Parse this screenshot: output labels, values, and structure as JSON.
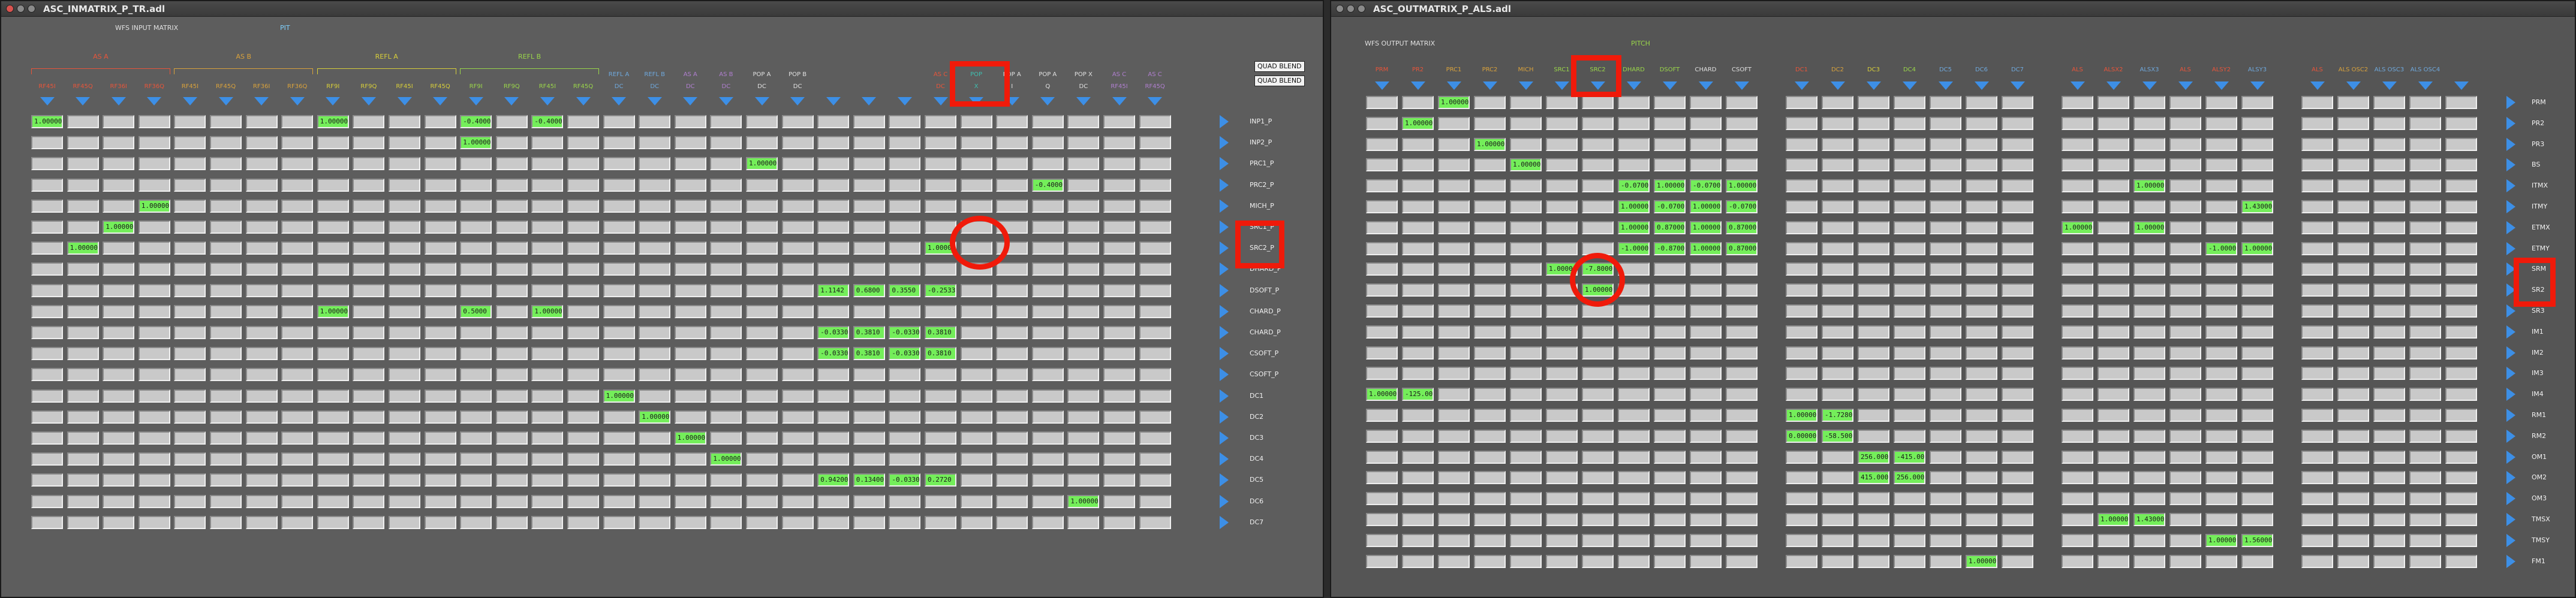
{
  "colors": {
    "cell": "#c9c9c9",
    "cell_value": "#74ee5a",
    "arrow": "#3d8fe6",
    "highlight": "#f01a0a",
    "bg": "#5d5d5d"
  },
  "left": {
    "title": "ASC_INMATRIX_P_TR.adl",
    "heading": "WFS INPUT MATRIX",
    "subheading": "PIT",
    "groups": [
      {
        "name": "AS A",
        "color": "#e8553a",
        "span": [
          0,
          3
        ]
      },
      {
        "name": "AS B",
        "color": "#d9a23c",
        "span": [
          4,
          7
        ]
      },
      {
        "name": "REFL A",
        "color": "#d8cf3a",
        "span": [
          8,
          11
        ]
      },
      {
        "name": "REFL B",
        "color": "#9ad64a",
        "span": [
          12,
          15
        ]
      }
    ],
    "columns": [
      {
        "top": "",
        "bottom": "RF45I",
        "color": "#e8553a"
      },
      {
        "top": "",
        "bottom": "RF45Q",
        "color": "#e8553a"
      },
      {
        "top": "",
        "bottom": "RF36I",
        "color": "#e8553a"
      },
      {
        "top": "",
        "bottom": "RF36Q",
        "color": "#e8553a"
      },
      {
        "top": "",
        "bottom": "RF45I",
        "color": "#d9a23c"
      },
      {
        "top": "",
        "bottom": "RF45Q",
        "color": "#d9a23c"
      },
      {
        "top": "",
        "bottom": "RF36I",
        "color": "#d9a23c"
      },
      {
        "top": "",
        "bottom": "RF36Q",
        "color": "#d9a23c"
      },
      {
        "top": "",
        "bottom": "RF9I",
        "color": "#d8cf3a"
      },
      {
        "top": "",
        "bottom": "RF9Q",
        "color": "#d8cf3a"
      },
      {
        "top": "",
        "bottom": "RF45I",
        "color": "#d8cf3a"
      },
      {
        "top": "",
        "bottom": "RF45Q",
        "color": "#d8cf3a"
      },
      {
        "top": "",
        "bottom": "RF9I",
        "color": "#9ad64a"
      },
      {
        "top": "",
        "bottom": "RF9Q",
        "color": "#9ad64a"
      },
      {
        "top": "",
        "bottom": "RF45I",
        "color": "#9ad64a"
      },
      {
        "top": "",
        "bottom": "RF45Q",
        "color": "#9ad64a"
      },
      {
        "top": "REFL A",
        "bottom": "DC",
        "color": "#6fa8dc"
      },
      {
        "top": "REFL B",
        "bottom": "DC",
        "color": "#6fa8dc"
      },
      {
        "top": "AS A",
        "bottom": "DC",
        "color": "#b07fcf"
      },
      {
        "top": "AS B",
        "bottom": "DC",
        "color": "#b07fcf"
      },
      {
        "top": "POP A",
        "bottom": "DC",
        "color": "#e0e0e0"
      },
      {
        "top": "POP B",
        "bottom": "DC",
        "color": "#e0e0e0"
      },
      {
        "top": "",
        "bottom": "",
        "color": "#e8553a"
      },
      {
        "top": "",
        "bottom": "",
        "color": "#e8553a"
      },
      {
        "top": "",
        "bottom": "",
        "color": "#e8553a"
      },
      {
        "top": "AS C",
        "bottom": "DC",
        "color": "#e8553a"
      },
      {
        "top": "POP",
        "bottom": "X",
        "color": "#3fbfb0"
      },
      {
        "top": "POP A",
        "bottom": "I",
        "color": "#e0e0e0"
      },
      {
        "top": "POP A",
        "bottom": "Q",
        "color": "#e0e0e0"
      },
      {
        "top": "POP X",
        "bottom": "DC",
        "color": "#e0e0e0"
      },
      {
        "top": "AS C",
        "bottom": "RF45I",
        "color": "#b07fcf"
      },
      {
        "top": "AS C",
        "bottom": "RF45Q",
        "color": "#b07fcf"
      }
    ],
    "blend": [
      "QUAD BLEND",
      "QUAD BLEND"
    ],
    "rows": [
      "INP1_P",
      "INP2_P",
      "PRC1_P",
      "PRC2_P",
      "MICH_P",
      "SRC1_P",
      "SRC2_P",
      "DHARD_P",
      "DSOFT_P",
      "CHARD_P",
      "CHARD_P",
      "CSOFT_P",
      "CSOFT_P",
      "DC1",
      "DC2",
      "DC3",
      "DC4",
      "DC5",
      "DC6",
      "DC7"
    ],
    "values": [
      {
        "r": 0,
        "c": 0,
        "v": "1.00000"
      },
      {
        "r": 0,
        "c": 8,
        "v": "1.00000"
      },
      {
        "r": 0,
        "c": 12,
        "v": "-0.4000"
      },
      {
        "r": 0,
        "c": 14,
        "v": "-0.4000"
      },
      {
        "r": 1,
        "c": 12,
        "v": "1.00000"
      },
      {
        "r": 2,
        "c": 20,
        "v": "1.00000"
      },
      {
        "r": 3,
        "c": 28,
        "v": "-0.4000"
      },
      {
        "r": 4,
        "c": 3,
        "v": "1.00000"
      },
      {
        "r": 5,
        "c": 2,
        "v": "1.00000"
      },
      {
        "r": 6,
        "c": 25,
        "v": "1.00000"
      },
      {
        "r": 6,
        "c": 1,
        "v": "1.00000"
      },
      {
        "r": 8,
        "c": 22,
        "v": "1.1142"
      },
      {
        "r": 8,
        "c": 23,
        "v": "0.6800"
      },
      {
        "r": 8,
        "c": 24,
        "v": "0.3550"
      },
      {
        "r": 8,
        "c": 25,
        "v": "-0.2533"
      },
      {
        "r": 9,
        "c": 8,
        "v": "1.00000"
      },
      {
        "r": 9,
        "c": 12,
        "v": "0.5000"
      },
      {
        "r": 9,
        "c": 14,
        "v": "1.00000"
      },
      {
        "r": 10,
        "c": 22,
        "v": "-0.0330"
      },
      {
        "r": 10,
        "c": 23,
        "v": "0.3810"
      },
      {
        "r": 10,
        "c": 24,
        "v": "-0.0330"
      },
      {
        "r": 10,
        "c": 25,
        "v": "0.3810"
      },
      {
        "r": 11,
        "c": 22,
        "v": "-0.0330"
      },
      {
        "r": 11,
        "c": 23,
        "v": "0.3810"
      },
      {
        "r": 11,
        "c": 24,
        "v": "-0.0330"
      },
      {
        "r": 11,
        "c": 25,
        "v": "0.3810"
      },
      {
        "r": 13,
        "c": 16,
        "v": "1.00000"
      },
      {
        "r": 14,
        "c": 17,
        "v": "1.00000"
      },
      {
        "r": 15,
        "c": 18,
        "v": "1.00000"
      },
      {
        "r": 16,
        "c": 19,
        "v": "1.00000"
      },
      {
        "r": 17,
        "c": 22,
        "v": "0.94200"
      },
      {
        "r": 17,
        "c": 23,
        "v": "0.13400"
      },
      {
        "r": 17,
        "c": 24,
        "v": "-0.0330"
      },
      {
        "r": 17,
        "c": 25,
        "v": "0.2720"
      },
      {
        "r": 18,
        "c": 29,
        "v": "1.00000"
      }
    ]
  },
  "right": {
    "title": "ASC_OUTMATRIX_P_ALS.adl",
    "heading": "WFS OUTPUT MATRIX",
    "subheading": "PITCH",
    "columns": [
      {
        "label": "PRM",
        "color": "#e8553a"
      },
      {
        "label": "PR2",
        "color": "#e8553a"
      },
      {
        "label": "PRC1",
        "color": "#d9a23c"
      },
      {
        "label": "PRC2",
        "color": "#d9a23c"
      },
      {
        "label": "MICH",
        "color": "#d9a23c"
      },
      {
        "label": "SRC1",
        "color": "#9ad64a"
      },
      {
        "label": "SRC2",
        "color": "#9ad64a"
      },
      {
        "label": "DHARD",
        "color": "#9ad64a"
      },
      {
        "label": "DSOFT",
        "color": "#9ad64a"
      },
      {
        "label": "CHARD",
        "color": "#e0e0e0"
      },
      {
        "label": "CSOFT",
        "color": "#e0e0e0"
      },
      {
        "label": "DC1",
        "color": "#e8553a"
      },
      {
        "label": "DC2",
        "color": "#d9a23c"
      },
      {
        "label": "DC3",
        "color": "#d8cf3a"
      },
      {
        "label": "DC4",
        "color": "#9ad64a"
      },
      {
        "label": "DC5",
        "color": "#6fa8dc"
      },
      {
        "label": "DC6",
        "color": "#6fa8dc"
      },
      {
        "label": "DC7",
        "color": "#6fa8dc"
      },
      {
        "label": "ALS",
        "color": "#e8553a"
      },
      {
        "label": "ALSX2",
        "color": "#e8553a"
      },
      {
        "label": "ALSX3",
        "color": "#6fa8dc"
      },
      {
        "label": "ALS",
        "color": "#e8553a"
      },
      {
        "label": "ALSY2",
        "color": "#e8553a"
      },
      {
        "label": "ALSY3",
        "color": "#6fa8dc"
      },
      {
        "label": "ALS",
        "color": "#e8553a"
      },
      {
        "label": "ALS OSC2",
        "color": "#d9a23c"
      },
      {
        "label": "ALS OSC3",
        "color": "#6fa8dc"
      },
      {
        "label": "ALS OSC4",
        "color": "#6fa8dc"
      },
      {
        "label": "",
        "color": "#e8553a"
      }
    ],
    "rows": [
      "PRM",
      "PR2",
      "PR3",
      "BS",
      "ITMX",
      "ITMY",
      "ETMX",
      "ETMY",
      "SRM",
      "SR2",
      "SR3",
      "IM1",
      "IM2",
      "IM3",
      "IM4",
      "RM1",
      "RM2",
      "OM1",
      "OM2",
      "OM3",
      "TMSX",
      "TMSY",
      "FM1"
    ],
    "values": [
      {
        "r": 0,
        "c": 2,
        "v": "1.00000"
      },
      {
        "r": 1,
        "c": 1,
        "v": "1.00000"
      },
      {
        "r": 2,
        "c": 3,
        "v": "1.00000"
      },
      {
        "r": 3,
        "c": 4,
        "v": "1.00000"
      },
      {
        "r": 4,
        "c": 7,
        "v": "-0.0700"
      },
      {
        "r": 4,
        "c": 8,
        "v": "1.00000"
      },
      {
        "r": 4,
        "c": 9,
        "v": "-0.0700"
      },
      {
        "r": 4,
        "c": 10,
        "v": "1.00000"
      },
      {
        "r": 4,
        "c": 20,
        "v": "1.00000"
      },
      {
        "r": 5,
        "c": 7,
        "v": "1.00000"
      },
      {
        "r": 5,
        "c": 8,
        "v": "-0.0700"
      },
      {
        "r": 5,
        "c": 9,
        "v": "1.00000"
      },
      {
        "r": 5,
        "c": 10,
        "v": "-0.0700"
      },
      {
        "r": 5,
        "c": 23,
        "v": "1.43000"
      },
      {
        "r": 6,
        "c": 7,
        "v": "1.00000"
      },
      {
        "r": 6,
        "c": 8,
        "v": "0.87000"
      },
      {
        "r": 6,
        "c": 9,
        "v": "1.00000"
      },
      {
        "r": 6,
        "c": 10,
        "v": "0.87000"
      },
      {
        "r": 6,
        "c": 18,
        "v": "1.00000"
      },
      {
        "r": 6,
        "c": 20,
        "v": "1.00000"
      },
      {
        "r": 7,
        "c": 7,
        "v": "-1.00000"
      },
      {
        "r": 7,
        "c": 8,
        "v": "-0.87000"
      },
      {
        "r": 7,
        "c": 9,
        "v": "1.00000"
      },
      {
        "r": 7,
        "c": 10,
        "v": "0.87000"
      },
      {
        "r": 7,
        "c": 22,
        "v": "-1.00000"
      },
      {
        "r": 7,
        "c": 23,
        "v": "1.00000"
      },
      {
        "r": 8,
        "c": 5,
        "v": "1.00000"
      },
      {
        "r": 8,
        "c": 6,
        "v": "-7.8000"
      },
      {
        "r": 9,
        "c": 6,
        "v": "1.00000"
      },
      {
        "r": 14,
        "c": 0,
        "v": "1.00000"
      },
      {
        "r": 14,
        "c": 1,
        "v": "-125.00"
      },
      {
        "r": 15,
        "c": 11,
        "v": "1.00000"
      },
      {
        "r": 15,
        "c": 12,
        "v": "-1.7280"
      },
      {
        "r": 16,
        "c": 11,
        "v": "0.00000"
      },
      {
        "r": 16,
        "c": 12,
        "v": "-58.500"
      },
      {
        "r": 17,
        "c": 13,
        "v": "256.000"
      },
      {
        "r": 17,
        "c": 14,
        "v": "-415.00"
      },
      {
        "r": 18,
        "c": 13,
        "v": "415.000"
      },
      {
        "r": 18,
        "c": 14,
        "v": "256.000"
      },
      {
        "r": 20,
        "c": 19,
        "v": "1.00000"
      },
      {
        "r": 20,
        "c": 20,
        "v": "1.43000"
      },
      {
        "r": 21,
        "c": 22,
        "v": "1.00000"
      },
      {
        "r": 21,
        "c": 23,
        "v": "1.56000"
      },
      {
        "r": 22,
        "c": 16,
        "v": "1.00000"
      }
    ]
  }
}
